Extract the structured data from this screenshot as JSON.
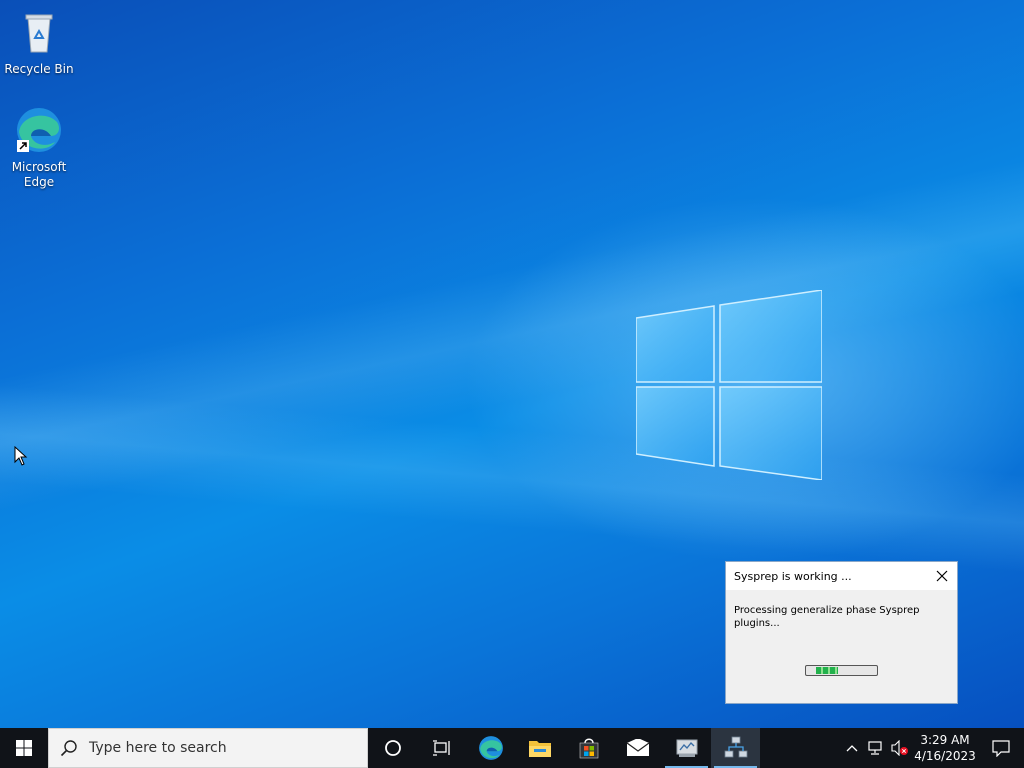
{
  "desktop": {
    "icons": [
      {
        "label": "Recycle Bin",
        "icon": "recycle-bin-icon"
      },
      {
        "label": "Microsoft Edge",
        "icon": "edge-icon"
      }
    ]
  },
  "dialog": {
    "title": "Sysprep is working ...",
    "message": "Processing generalize phase Sysprep plugins...",
    "progress_state": "indeterminate"
  },
  "taskbar": {
    "search_placeholder": "Type here to search",
    "apps": [
      {
        "name": "Cortana",
        "icon": "cortana-icon"
      },
      {
        "name": "Task View",
        "icon": "task-view-icon"
      },
      {
        "name": "Microsoft Edge",
        "icon": "edge-icon"
      },
      {
        "name": "File Explorer",
        "icon": "file-explorer-icon"
      },
      {
        "name": "Microsoft Store",
        "icon": "store-icon"
      },
      {
        "name": "Mail",
        "icon": "mail-icon"
      },
      {
        "name": "Server Manager",
        "icon": "server-manager-icon"
      },
      {
        "name": "Sysprep",
        "icon": "sysprep-icon"
      }
    ],
    "tray": {
      "time": "3:29 AM",
      "date": "4/16/2023"
    }
  },
  "colors": {
    "taskbar_bg": "#101318",
    "desktop_accent": "#0a74d8",
    "running_indicator": "#76b9ed"
  }
}
